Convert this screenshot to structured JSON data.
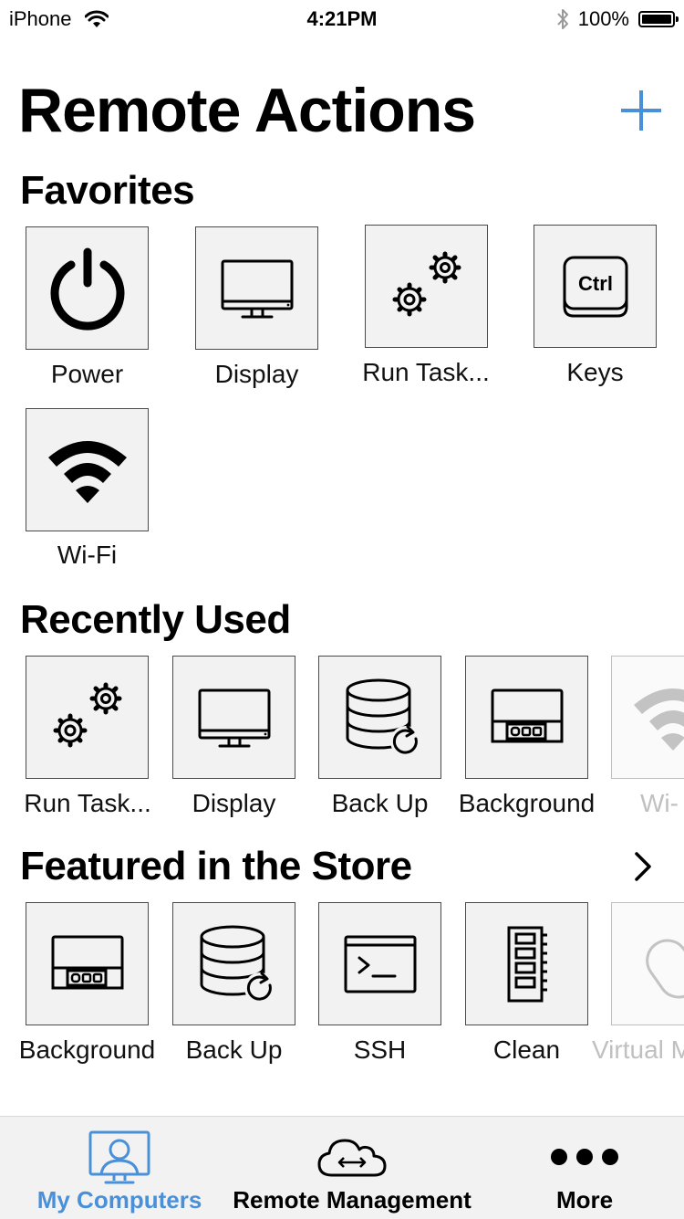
{
  "status_bar": {
    "carrier": "iPhone",
    "time": "4:21PM",
    "battery": "100%"
  },
  "header": {
    "title": "Remote Actions"
  },
  "favorites": {
    "title": "Favorites",
    "items": [
      {
        "label": "Power",
        "icon": "power-icon"
      },
      {
        "label": "Display",
        "icon": "monitor-icon"
      },
      {
        "label": "Run Task...",
        "icon": "gears-icon"
      },
      {
        "label": "Keys",
        "icon": "ctrl-key-icon",
        "key_text": "Ctrl"
      },
      {
        "label": "Wi-Fi",
        "icon": "wifi-icon"
      }
    ]
  },
  "recently_used": {
    "title": "Recently Used",
    "items": [
      {
        "label": "Run Task...",
        "icon": "gears-icon"
      },
      {
        "label": "Display",
        "icon": "monitor-icon"
      },
      {
        "label": "Back Up",
        "icon": "database-refresh-icon"
      },
      {
        "label": "Background",
        "icon": "background-icon"
      },
      {
        "label": "Wi-",
        "icon": "wifi-icon"
      }
    ]
  },
  "featured": {
    "title": "Featured in the Store",
    "items": [
      {
        "label": "Background",
        "icon": "background-icon"
      },
      {
        "label": "Back Up",
        "icon": "database-refresh-icon"
      },
      {
        "label": "SSH",
        "icon": "terminal-icon"
      },
      {
        "label": "Clean",
        "icon": "memory-icon"
      },
      {
        "label": "Virtual M",
        "icon": "mouse-icon"
      }
    ]
  },
  "tab_bar": {
    "items": [
      {
        "label": "My Computers",
        "active": true
      },
      {
        "label": "Remote Management",
        "active": false
      },
      {
        "label": "More",
        "active": false
      }
    ]
  },
  "colors": {
    "accent": "#4a90d9",
    "tile_bg": "#f2f2f2",
    "tab_bar_bg": "#f2f2f2"
  }
}
